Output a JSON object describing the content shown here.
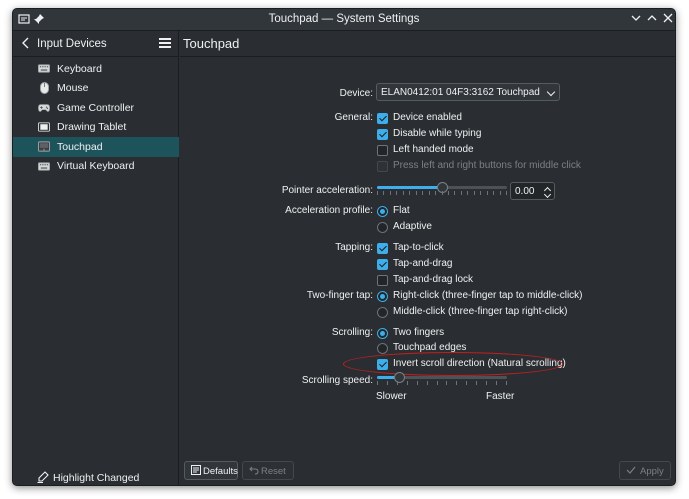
{
  "window": {
    "title": "Touchpad — System Settings"
  },
  "sidebar": {
    "back_label": "Input Devices",
    "items": [
      {
        "label": "Keyboard",
        "icon": "keyboard-icon"
      },
      {
        "label": "Mouse",
        "icon": "mouse-icon"
      },
      {
        "label": "Game Controller",
        "icon": "gamepad-icon"
      },
      {
        "label": "Drawing Tablet",
        "icon": "tablet-icon"
      },
      {
        "label": "Touchpad",
        "icon": "touchpad-icon",
        "active": true
      },
      {
        "label": "Virtual Keyboard",
        "icon": "virtual-keyboard-icon"
      }
    ],
    "highlight_label": "Highlight Changed Settings"
  },
  "main": {
    "title": "Touchpad",
    "device_label": "Device:",
    "device_value": "ELAN0412:01 04F3:3162 Touchpad",
    "general_label": "General:",
    "general_options": [
      {
        "label": "Device enabled",
        "checked": true
      },
      {
        "label": "Disable while typing",
        "checked": true
      },
      {
        "label": "Left handed mode",
        "checked": false
      },
      {
        "label": "Press left and right buttons for middle click",
        "checked": false,
        "disabled": true
      }
    ],
    "pointer_accel_label": "Pointer acceleration:",
    "pointer_accel_value": "0.00",
    "pointer_accel_level": 0.5,
    "accel_profile_label": "Acceleration profile:",
    "accel_profile_options": [
      {
        "label": "Flat",
        "checked": true
      },
      {
        "label": "Adaptive",
        "checked": false
      }
    ],
    "tapping_label": "Tapping:",
    "tapping_options": [
      {
        "label": "Tap-to-click",
        "checked": true
      },
      {
        "label": "Tap-and-drag",
        "checked": true
      },
      {
        "label": "Tap-and-drag lock",
        "checked": false
      }
    ],
    "two_finger_label": "Two-finger tap:",
    "two_finger_options": [
      {
        "label": "Right-click (three-finger tap to middle-click)",
        "checked": true
      },
      {
        "label": "Middle-click (three-finger tap right-click)",
        "checked": false
      }
    ],
    "scrolling_label": "Scrolling:",
    "scrolling_options": [
      {
        "label": "Two fingers",
        "checked": true
      },
      {
        "label": "Touchpad edges",
        "checked": false
      }
    ],
    "invert_scroll_label": "Invert scroll direction (Natural scrolling)",
    "invert_scroll_checked": true,
    "scroll_speed_label": "Scrolling speed:",
    "scroll_speed_level": 0.17,
    "slower_label": "Slower",
    "faster_label": "Faster"
  },
  "footer": {
    "defaults_label": "Defaults",
    "reset_label": "Reset",
    "apply_label": "Apply"
  },
  "colors": {
    "accent": "#3daee9",
    "annotation": "#c41f1f",
    "background": "#2a2e32"
  }
}
